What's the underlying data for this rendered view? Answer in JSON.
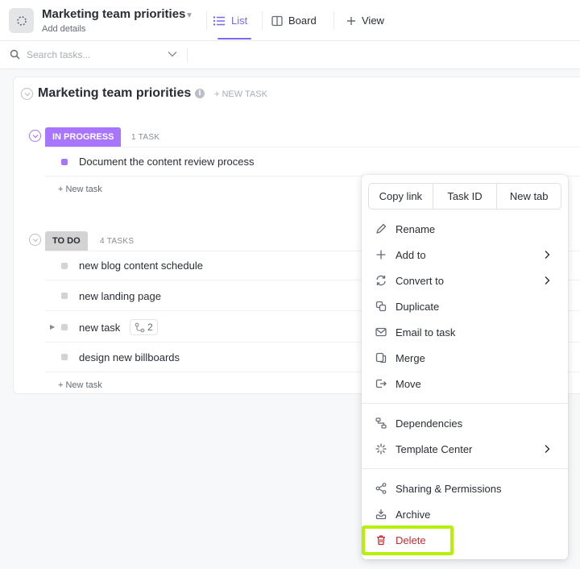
{
  "header": {
    "title": "Marketing team priorities",
    "subtitle": "Add details",
    "tabs": [
      {
        "label": "List",
        "icon": "list-icon",
        "active": true
      },
      {
        "label": "Board",
        "icon": "board-icon"
      },
      {
        "label": "View",
        "icon": "plus-icon"
      }
    ]
  },
  "search": {
    "placeholder": "Search tasks..."
  },
  "list": {
    "title": "Marketing team priorities",
    "new_task_label": "+ NEW TASK",
    "groups": [
      {
        "status": "IN PROGRESS",
        "color": "#a875ff",
        "count": "1 TASK",
        "tasks": [
          {
            "name": "Document the content review process",
            "dot_color": "#a875ff"
          }
        ],
        "new_task": "+ New task"
      },
      {
        "status": "TO DO",
        "color": "#d3d3d3",
        "count": "4 TASKS",
        "tasks": [
          {
            "name": "new blog content schedule",
            "dot_color": "#d3d3d3"
          },
          {
            "name": "new landing page",
            "dot_color": "#d3d3d3"
          },
          {
            "name": "new task",
            "dot_color": "#d3d3d3",
            "subtasks": "2"
          },
          {
            "name": "design new billboards",
            "dot_color": "#d3d3d3"
          }
        ],
        "new_task": "+ New task"
      }
    ]
  },
  "menu": {
    "top_buttons": [
      "Copy link",
      "Task ID",
      "New tab"
    ],
    "items": [
      {
        "label": "Rename",
        "icon": "pencil-icon"
      },
      {
        "label": "Add to",
        "icon": "plus-icon",
        "submenu": true
      },
      {
        "label": "Convert to",
        "icon": "convert-icon",
        "submenu": true
      },
      {
        "label": "Duplicate",
        "icon": "duplicate-icon"
      },
      {
        "label": "Email to task",
        "icon": "email-icon"
      },
      {
        "label": "Merge",
        "icon": "merge-icon"
      },
      {
        "label": "Move",
        "icon": "move-icon"
      },
      {
        "label": "Dependencies",
        "icon": "dependencies-icon"
      },
      {
        "label": "Template Center",
        "icon": "template-icon",
        "submenu": true
      },
      {
        "label": "Sharing & Permissions",
        "icon": "share-icon"
      },
      {
        "label": "Archive",
        "icon": "archive-icon"
      },
      {
        "label": "Delete",
        "icon": "trash-icon",
        "danger": true,
        "highlighted": true
      }
    ]
  },
  "colors": {
    "accent": "#7b68ee",
    "danger": "#c62a2f",
    "highlight": "#b6f005"
  }
}
